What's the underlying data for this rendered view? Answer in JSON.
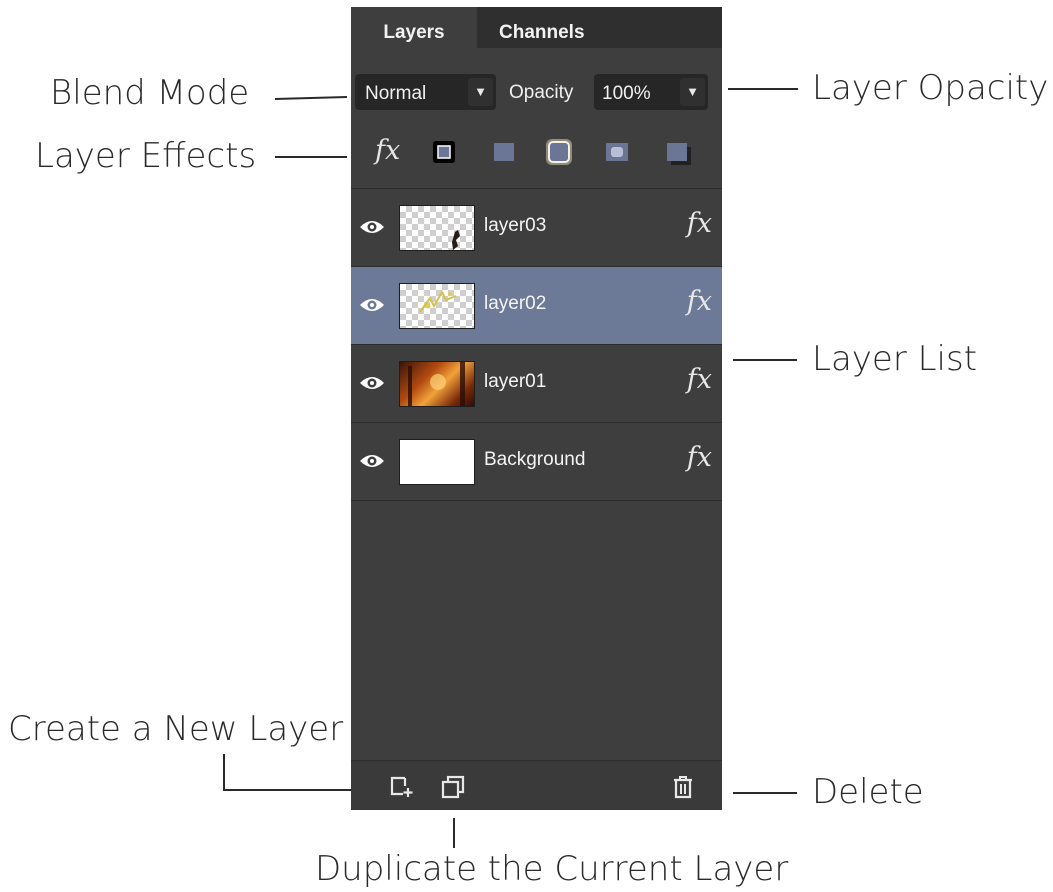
{
  "tabs": {
    "layers": "Layers",
    "channels": "Channels"
  },
  "controls": {
    "blend_mode": "Normal",
    "opacity_label": "Opacity",
    "opacity_value": "100%"
  },
  "effects": {
    "fx_label": "fx",
    "items": [
      "effect-icon",
      "effect-icon",
      "effect-icon",
      "effect-icon",
      "effect-icon"
    ]
  },
  "layers": [
    {
      "name": "layer03",
      "fx": "fx",
      "selected": false,
      "visible": true
    },
    {
      "name": "layer02",
      "fx": "fx",
      "selected": true,
      "visible": true
    },
    {
      "name": "layer01",
      "fx": "fx",
      "selected": false,
      "visible": true
    },
    {
      "name": "Background",
      "fx": "fx",
      "selected": false,
      "visible": true
    }
  ],
  "callouts": {
    "blend_mode": "Blend Mode",
    "layer_effects": "Layer Effects",
    "layer_opacity": "Layer Opacity",
    "layer_list": "Layer List",
    "create_new_layer": "Create a New Layer",
    "delete": "Delete",
    "duplicate": "Duplicate the Current Layer"
  },
  "colors": {
    "panel": "#3e3e3e",
    "tab_bar": "#2f2f2f",
    "selected_row": "#6d7a97"
  }
}
